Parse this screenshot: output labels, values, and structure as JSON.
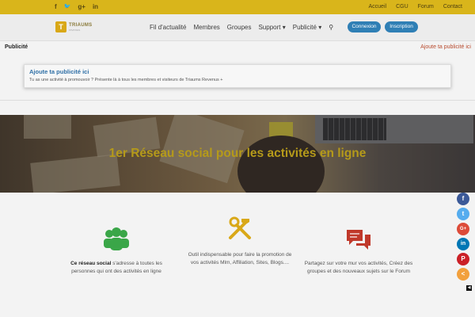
{
  "topbar": {
    "social": [
      {
        "icon": "facebook-icon",
        "glyph": "f"
      },
      {
        "icon": "twitter-icon",
        "glyph": "🐦"
      },
      {
        "icon": "google-plus-icon",
        "glyph": "g+"
      },
      {
        "icon": "linkedin-icon",
        "glyph": "in"
      }
    ],
    "links": [
      "Accueil",
      "CGU",
      "Forum",
      "Contact"
    ]
  },
  "header": {
    "logo_mark": "T",
    "logo_text": "TRIAUMS",
    "logo_sub": "revenus",
    "nav": [
      "Fil d'actualité",
      "Membres",
      "Groupes",
      "Support ▾",
      "Publicité ▾"
    ],
    "search_glyph": "⚲",
    "login_label": "Connexion",
    "signup_label": "Inscription"
  },
  "pub_row": {
    "left": "Publicité",
    "right": "Ajoute ta publicité ici"
  },
  "ad": {
    "title": "Ajoute ta publicité ici",
    "desc": "Tu as une activité à promouvoir ? Présente là à tous les membres et visiteurs de Triaums Revenus +"
  },
  "hero": {
    "title": "1er Réseau social pour les activités en ligne"
  },
  "features": [
    {
      "bold": "Ce réseau social",
      "text": " s'adresse à toutes les personnes qui ont des activités en ligne"
    },
    {
      "bold": "",
      "text": "Outil indispensable pour faire la promotion de vos activités Mlm, Affiliation, Sites, Blogs...."
    },
    {
      "bold": "",
      "text": "Partagez sur votre mur vos activités, Créez des groupes et des nouveaux sujets sur le Forum"
    }
  ],
  "share": [
    {
      "icon": "facebook-share-icon",
      "glyph": "f",
      "color": "#3b5998"
    },
    {
      "icon": "twitter-share-icon",
      "glyph": "t",
      "color": "#55acee"
    },
    {
      "icon": "google-plus-share-icon",
      "glyph": "G+",
      "color": "#dd4b39"
    },
    {
      "icon": "linkedin-share-icon",
      "glyph": "in",
      "color": "#0077b5"
    },
    {
      "icon": "pinterest-share-icon",
      "glyph": "P",
      "color": "#cb2027"
    },
    {
      "icon": "share-more-icon",
      "glyph": "<",
      "color": "#f2a03d"
    }
  ],
  "colors": {
    "topbar": "#d9b51b",
    "button": "#2f7fb5",
    "hero_title": "#b59a1a",
    "icon_people": "#3aa648",
    "icon_tools": "#d9a818",
    "icon_chat": "#c0392b"
  }
}
